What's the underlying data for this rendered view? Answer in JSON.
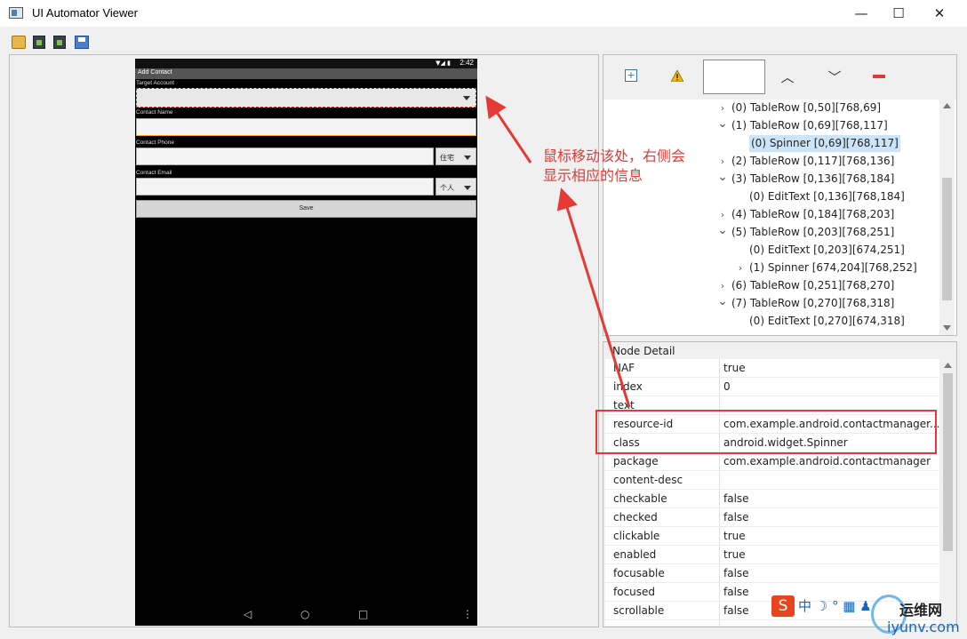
{
  "window": {
    "title": "UI Automator Viewer",
    "minimize": "—",
    "maximize": "☐",
    "close": "✕"
  },
  "toolbar": {
    "icons": [
      "open-folder-icon",
      "device-screenshot-icon",
      "device-screenshot-compressed-icon",
      "save-icon"
    ]
  },
  "phone": {
    "status_time": "2:42",
    "status_icons": "▼◢ ▮",
    "app_title": "Add Contact",
    "fields": [
      {
        "label": "Target Account"
      },
      {
        "label": "Contact Name"
      },
      {
        "label": "Contact Phone",
        "spinner": "住宅"
      },
      {
        "label": "Contact Email",
        "spinner": "个人"
      }
    ],
    "save_label": "Save",
    "nav": {
      "back": "◁",
      "home": "○",
      "recents": "□",
      "menu": "⋮"
    }
  },
  "tree_toolbar": {
    "icons": [
      "expand-all-icon",
      "warning-icon",
      "search-box",
      "previous-icon",
      "next-icon",
      "clear-icon"
    ],
    "warn_color": "#f2b705",
    "clear_color": "#e53935"
  },
  "tree": {
    "nodes": [
      {
        "label": "(0) TableRow [0,50][768,69]",
        "expander": ">",
        "level": 1
      },
      {
        "label": "(1) TableRow [0,69][768,117]",
        "expander": "v",
        "level": 1
      },
      {
        "label": "(0) Spinner [0,69][768,117]",
        "expander": "",
        "level": 2,
        "selected": true
      },
      {
        "label": "(2) TableRow [0,117][768,136]",
        "expander": ">",
        "level": 1
      },
      {
        "label": "(3) TableRow [0,136][768,184]",
        "expander": "v",
        "level": 1
      },
      {
        "label": "(0) EditText [0,136][768,184]",
        "expander": "",
        "level": 2
      },
      {
        "label": "(4) TableRow [0,184][768,203]",
        "expander": ">",
        "level": 1
      },
      {
        "label": "(5) TableRow [0,203][768,251]",
        "expander": "v",
        "level": 1
      },
      {
        "label": "(0) EditText [0,203][674,251]",
        "expander": "",
        "level": 2
      },
      {
        "label": "(1) Spinner [674,204][768,252]",
        "expander": ">",
        "level": 2
      },
      {
        "label": "(6) TableRow [0,251][768,270]",
        "expander": ">",
        "level": 1
      },
      {
        "label": "(7) TableRow [0,270][768,318]",
        "expander": "v",
        "level": 1
      },
      {
        "label": "(0) EditText [0,270][674,318]",
        "expander": "",
        "level": 2
      }
    ]
  },
  "node_detail": {
    "title": "Node Detail",
    "rows": [
      {
        "key": "NAF",
        "value": "true"
      },
      {
        "key": "index",
        "value": "0"
      },
      {
        "key": "text",
        "value": ""
      },
      {
        "key": "resource-id",
        "value": "com.example.android.contactmanager..."
      },
      {
        "key": "class",
        "value": "android.widget.Spinner"
      },
      {
        "key": "package",
        "value": "com.example.android.contactmanager"
      },
      {
        "key": "content-desc",
        "value": ""
      },
      {
        "key": "checkable",
        "value": "false"
      },
      {
        "key": "checked",
        "value": "false"
      },
      {
        "key": "clickable",
        "value": "true"
      },
      {
        "key": "enabled",
        "value": "true"
      },
      {
        "key": "focusable",
        "value": "false"
      },
      {
        "key": "focused",
        "value": "false"
      },
      {
        "key": "scrollable",
        "value": "false"
      }
    ]
  },
  "annotation": {
    "line1": "鼠标移动该处，右侧会",
    "line2": "显示相应的信息",
    "color": "#e53935"
  },
  "watermark": {
    "s": "S",
    "ime": "中 ☽ ° ▦ ♟",
    "brand": "运维网",
    "url": "iyunv.com"
  }
}
